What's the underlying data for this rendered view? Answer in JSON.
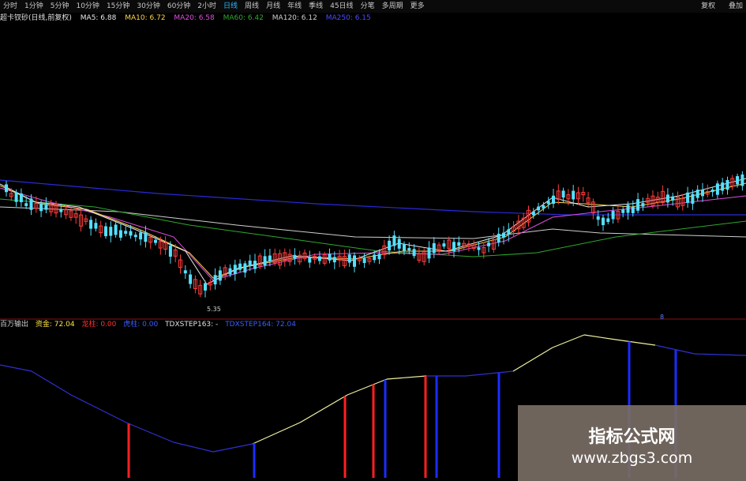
{
  "toolbar": {
    "tabs": [
      "分时",
      "1分钟",
      "5分钟",
      "10分钟",
      "15分钟",
      "30分钟",
      "60分钟",
      "2小时",
      "日线",
      "周线",
      "月线",
      "年线",
      "季线",
      "45日线",
      "分笔",
      "多周期",
      "更多"
    ],
    "active_index": 8,
    "right_buttons": [
      "复权",
      "叠加"
    ]
  },
  "ma_info": {
    "stock_label": "超卡钗砂(日线,前复权)",
    "ma5": "MA5: 6.88",
    "ma10": "MA10: 6.72",
    "ma20": "MA20: 6.58",
    "ma60": "MA60: 6.42",
    "ma120": "MA120: 6.12",
    "ma250": "MA250: 6.15"
  },
  "price_labels": {
    "low": "5.35",
    "marker": "8"
  },
  "indicator": {
    "name": "百万输出",
    "v1": "资金: 72.04",
    "v2": "龙柱: 0.00",
    "v3": "虎柱: 0.00",
    "v4": "TDXSTEP163: -",
    "v5": "TDXSTEP164: 72.04"
  },
  "colors": {
    "up": "#ff3b3b",
    "down": "#54e0ff",
    "ma5": "#e8e8e8",
    "ma10": "#ffd54a",
    "ma20": "#e04ee0",
    "ma60": "#2ea82e",
    "ma120": "#cfcfcf",
    "ma250": "#2a2ad8",
    "red_bar": "#ff2020",
    "blue_bar": "#1a2cff",
    "osc_high": "#f0f0a0",
    "osc_low": "#3030d0"
  },
  "watermark": {
    "title": "指标公式网",
    "url": "www.zbgs3.com"
  }
}
